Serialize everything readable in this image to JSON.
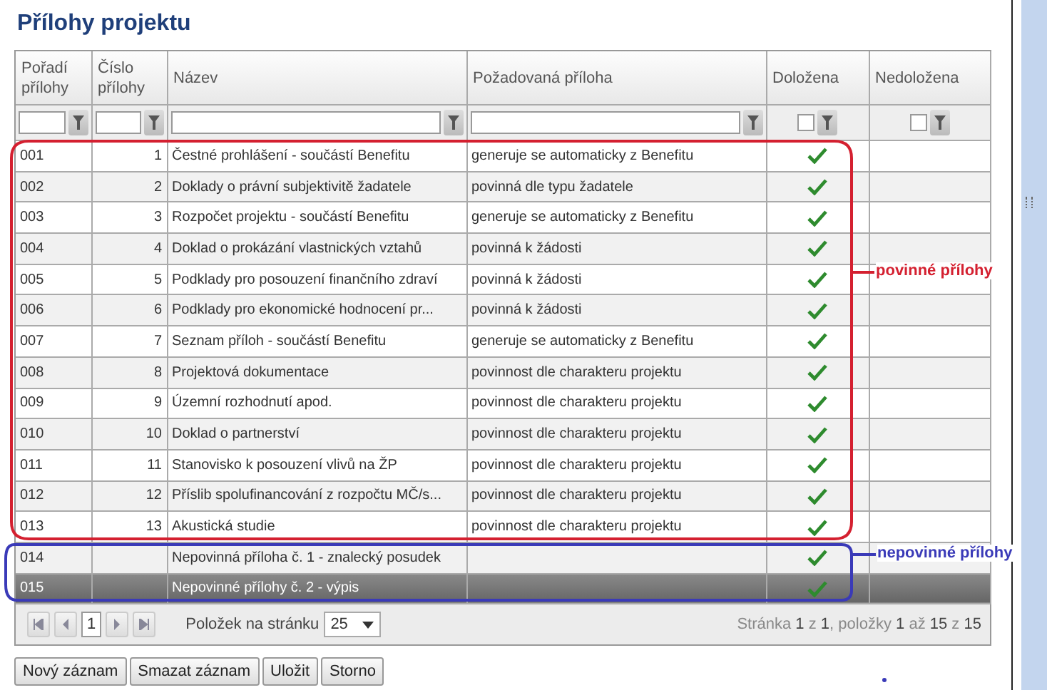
{
  "title": "Přílohy projektu",
  "table": {
    "columns": [
      "Pořadí přílohy",
      "Číslo přílohy",
      "Název",
      "Požadovaná příloha",
      "Doložena",
      "Nedoložena"
    ],
    "filters": {
      "doložena_checked": false,
      "nedoložena_checked": false
    },
    "rows": [
      {
        "order": "001",
        "number": "1",
        "name": "Čestné prohlášení - součástí Benefitu",
        "required": "generuje se automaticky z Benefitu",
        "supplied": true,
        "selected": false
      },
      {
        "order": "002",
        "number": "2",
        "name": "Doklady o právní subjektivitě žadatele",
        "required": "povinná dle typu žadatele",
        "supplied": true,
        "selected": false
      },
      {
        "order": "003",
        "number": "3",
        "name": "Rozpočet projektu - součástí Benefitu",
        "required": "generuje se automaticky z Benefitu",
        "supplied": true,
        "selected": false
      },
      {
        "order": "004",
        "number": "4",
        "name": "Doklad o prokázání vlastnických vztahů",
        "required": "povinná k žádosti",
        "supplied": true,
        "selected": false
      },
      {
        "order": "005",
        "number": "5",
        "name": "Podklady pro posouzení finančního zdraví",
        "required": "povinná k žádosti",
        "supplied": true,
        "selected": false
      },
      {
        "order": "006",
        "number": "6",
        "name": "Podklady pro ekonomické hodnocení pr...",
        "required": "povinná k žádosti",
        "supplied": true,
        "selected": false
      },
      {
        "order": "007",
        "number": "7",
        "name": "Seznam příloh - součástí Benefitu",
        "required": "generuje se automaticky z Benefitu",
        "supplied": true,
        "selected": false
      },
      {
        "order": "008",
        "number": "8",
        "name": "Projektová dokumentace",
        "required": "povinnost dle charakteru projektu",
        "supplied": true,
        "selected": false
      },
      {
        "order": "009",
        "number": "9",
        "name": "Územní rozhodnutí apod.",
        "required": "povinnost dle charakteru projektu",
        "supplied": true,
        "selected": false
      },
      {
        "order": "010",
        "number": "10",
        "name": "Doklad o partnerství",
        "required": "povinnost dle charakteru projektu",
        "supplied": true,
        "selected": false
      },
      {
        "order": "011",
        "number": "11",
        "name": "Stanovisko k posouzení vlivů na ŽP",
        "required": "povinnost dle charakteru projektu",
        "supplied": true,
        "selected": false
      },
      {
        "order": "012",
        "number": "12",
        "name": "Příslib spolufinancování z rozpočtu MČ/s...",
        "required": "povinnost dle charakteru projektu",
        "supplied": true,
        "selected": false
      },
      {
        "order": "013",
        "number": "13",
        "name": "Akustická studie",
        "required": "povinnost dle charakteru projektu",
        "supplied": true,
        "selected": false
      },
      {
        "order": "014",
        "name": "Nepovinná příloha č. 1 - znalecký posudek",
        "supplied": true,
        "selected": false
      },
      {
        "order": "015",
        "name": "Nepovinné přílohy č. 2 - výpis",
        "supplied": true,
        "selected": true
      }
    ]
  },
  "pager": {
    "page": "1",
    "page_size_label": "Položek na stránku",
    "page_size": "25",
    "summary": "Stránka **1** z **1**, položky **1** až **15** z **15**"
  },
  "buttons": [
    "Nový záznam",
    "Smazat záznam",
    "Uložit",
    "Storno"
  ],
  "annotations": [
    {
      "label": "povinné přílohy",
      "color": "#d42030"
    },
    {
      "label": "nepovinné přílohy",
      "color": "#3a3ab8"
    }
  ]
}
